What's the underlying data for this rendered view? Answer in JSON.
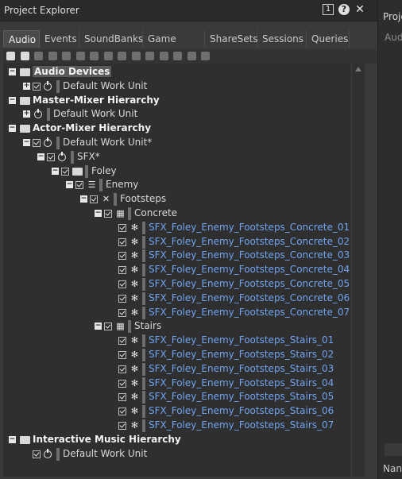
{
  "window": {
    "title": "Project Explorer",
    "pin_label": "1",
    "help_glyph": "?",
    "close_glyph": "✕"
  },
  "tabs": [
    "Audio",
    "Events",
    "SoundBanks",
    "Game Syncs",
    "ShareSets",
    "Sessions",
    "Queries"
  ],
  "active_tab": "Audio",
  "toolbar_icons": [
    "power-icon",
    "folder-icon",
    "work-unit-icon",
    "blend-icon",
    "grid-icon",
    "list-icon",
    "sequence-icon",
    "random-icon",
    "switch-icon",
    "music-icon",
    "stop-icon",
    "record-icon",
    "split-icon",
    "layout-icon",
    "layout2-icon"
  ],
  "tree": [
    {
      "label": "Audio Devices",
      "bold": true,
      "selected": true,
      "depth": 0,
      "expander": "-",
      "icon": "folder"
    },
    {
      "label": "Default Work Unit",
      "depth": 1,
      "expander": "+",
      "icon": "pwr",
      "check": true
    },
    {
      "label": "Master-Mixer Hierarchy",
      "bold": true,
      "depth": 0,
      "expander": "-",
      "icon": "folder"
    },
    {
      "label": "Default Work Unit",
      "depth": 1,
      "expander": "+",
      "icon": "pwr"
    },
    {
      "label": "Actor-Mixer Hierarchy",
      "bold": true,
      "depth": 0,
      "expander": "-",
      "icon": "folder"
    },
    {
      "label": "Default Work Unit*",
      "depth": 1,
      "expander": "-",
      "icon": "pwr",
      "check": true
    },
    {
      "label": "SFX*",
      "depth": 2,
      "expander": "-",
      "icon": "pwr",
      "check": true
    },
    {
      "label": "Foley",
      "depth": 3,
      "expander": "-",
      "icon": "folder",
      "check": true
    },
    {
      "label": "Enemy",
      "depth": 4,
      "expander": "-",
      "icon": "blend",
      "check": true
    },
    {
      "label": "Footsteps",
      "depth": 5,
      "expander": "-",
      "icon": "random",
      "check": true
    },
    {
      "label": "Concrete",
      "depth": 6,
      "expander": "-",
      "icon": "grid",
      "check": true
    },
    {
      "label": "SFX_Foley_Enemy_Footsteps_Concrete_01",
      "depth": 7,
      "icon": "sound",
      "check": true,
      "sound": true
    },
    {
      "label": "SFX_Foley_Enemy_Footsteps_Concrete_02",
      "depth": 7,
      "icon": "sound",
      "check": true,
      "sound": true
    },
    {
      "label": "SFX_Foley_Enemy_Footsteps_Concrete_03",
      "depth": 7,
      "icon": "sound",
      "check": true,
      "sound": true
    },
    {
      "label": "SFX_Foley_Enemy_Footsteps_Concrete_04",
      "depth": 7,
      "icon": "sound",
      "check": true,
      "sound": true
    },
    {
      "label": "SFX_Foley_Enemy_Footsteps_Concrete_05",
      "depth": 7,
      "icon": "sound",
      "check": true,
      "sound": true
    },
    {
      "label": "SFX_Foley_Enemy_Footsteps_Concrete_06",
      "depth": 7,
      "icon": "sound",
      "check": true,
      "sound": true
    },
    {
      "label": "SFX_Foley_Enemy_Footsteps_Concrete_07",
      "depth": 7,
      "icon": "sound",
      "check": true,
      "sound": true
    },
    {
      "label": "Stairs",
      "depth": 6,
      "expander": "-",
      "icon": "grid",
      "check": true
    },
    {
      "label": "SFX_Foley_Enemy_Footsteps_Stairs_01",
      "depth": 7,
      "icon": "sound",
      "check": true,
      "sound": true
    },
    {
      "label": "SFX_Foley_Enemy_Footsteps_Stairs_02",
      "depth": 7,
      "icon": "sound",
      "check": true,
      "sound": true
    },
    {
      "label": "SFX_Foley_Enemy_Footsteps_Stairs_03",
      "depth": 7,
      "icon": "sound",
      "check": true,
      "sound": true
    },
    {
      "label": "SFX_Foley_Enemy_Footsteps_Stairs_04",
      "depth": 7,
      "icon": "sound",
      "check": true,
      "sound": true
    },
    {
      "label": "SFX_Foley_Enemy_Footsteps_Stairs_05",
      "depth": 7,
      "icon": "sound",
      "check": true,
      "sound": true
    },
    {
      "label": "SFX_Foley_Enemy_Footsteps_Stairs_06",
      "depth": 7,
      "icon": "sound",
      "check": true,
      "sound": true
    },
    {
      "label": "SFX_Foley_Enemy_Footsteps_Stairs_07",
      "depth": 7,
      "icon": "sound",
      "check": true,
      "sound": true
    },
    {
      "label": "Interactive Music Hierarchy",
      "bold": true,
      "depth": 0,
      "expander": "-",
      "icon": "folder"
    },
    {
      "label": "Default Work Unit",
      "depth": 1,
      "icon": "pwr",
      "check": true
    }
  ],
  "right_panel": {
    "title": "Proje",
    "tab": "Aud",
    "name_header": "Nan"
  },
  "colors": {
    "sound_text": "#6fa3f0",
    "panel_bg": "#3a3a3a",
    "tree_bg": "#2f2f2f"
  }
}
